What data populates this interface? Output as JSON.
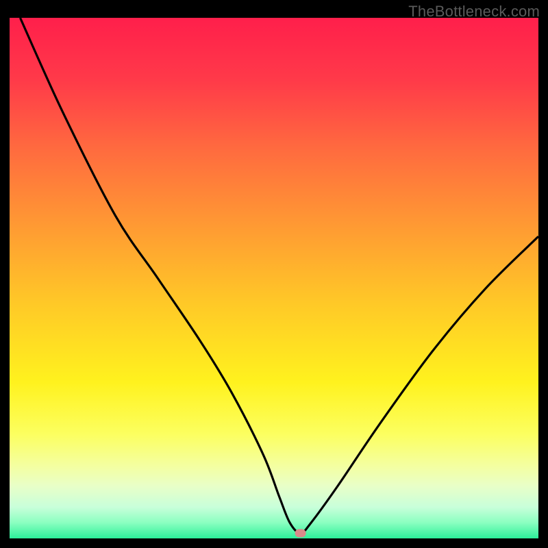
{
  "watermark": "TheBottleneck.com",
  "chart_data": {
    "type": "line",
    "title": "",
    "xlabel": "",
    "ylabel": "",
    "xlim": [
      0,
      100
    ],
    "ylim": [
      0,
      100
    ],
    "grid": false,
    "legend": false,
    "description": "Bottleneck curve with V-shaped minimum on a red-to-green vertical gradient background",
    "series": [
      {
        "name": "bottleneck-curve",
        "x": [
          2,
          10,
          20,
          28,
          36,
          42,
          48,
          51,
          53,
          55,
          57,
          62,
          70,
          80,
          90,
          100
        ],
        "values": [
          100,
          82,
          62,
          50,
          38,
          28,
          16,
          8,
          3,
          1,
          3,
          10,
          22,
          36,
          48,
          58
        ]
      }
    ],
    "marker": {
      "name": "optimal-point",
      "x": 55,
      "y": 1,
      "color": "#d98a8a",
      "shape": "pill"
    },
    "gradient_stops": [
      {
        "offset": 0,
        "color": "#ff1f4b"
      },
      {
        "offset": 12,
        "color": "#ff3a49"
      },
      {
        "offset": 25,
        "color": "#ff6a3f"
      },
      {
        "offset": 40,
        "color": "#ff9a33"
      },
      {
        "offset": 55,
        "color": "#ffc927"
      },
      {
        "offset": 70,
        "color": "#fff21e"
      },
      {
        "offset": 80,
        "color": "#fcff60"
      },
      {
        "offset": 86,
        "color": "#f4ffa0"
      },
      {
        "offset": 90,
        "color": "#e8ffc8"
      },
      {
        "offset": 94,
        "color": "#c8ffda"
      },
      {
        "offset": 97,
        "color": "#8affc0"
      },
      {
        "offset": 100,
        "color": "#2cf09a"
      }
    ]
  }
}
